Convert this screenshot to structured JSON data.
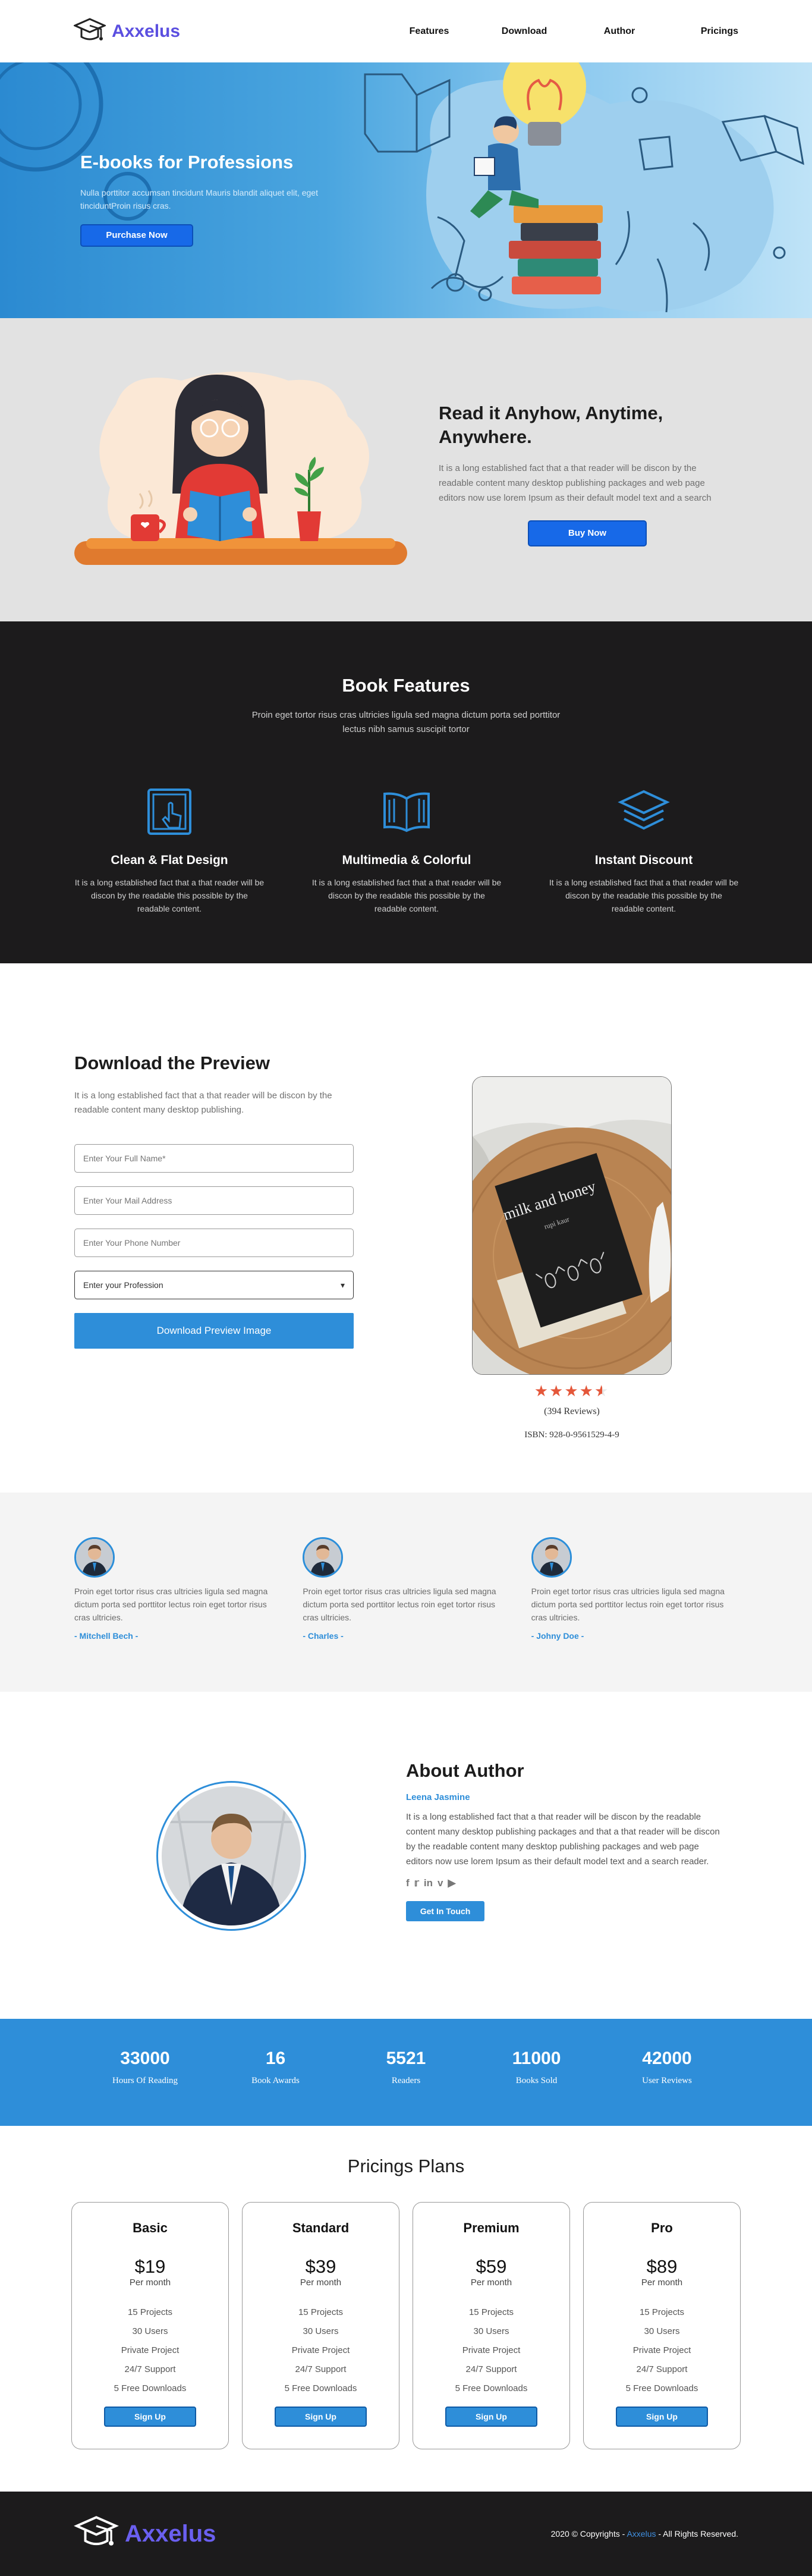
{
  "nav": {
    "brand": "Axxelus",
    "items": [
      "Features",
      "Download",
      "Author",
      "Pricings"
    ]
  },
  "hero": {
    "title": "E-books for Professions",
    "text": "Nulla porttitor accumsan tincidunt Mauris blandit aliquet elit, eget tinciduntProin risus cras.",
    "button": "Purchase Now"
  },
  "read": {
    "title": "Read it Anyhow, Anytime, Anywhere.",
    "text": "It is a long established fact that a that reader will be discon by the readable content many desktop publishing packages and web page editors now use lorem Ipsum as their default model text and a search",
    "button": "Buy Now"
  },
  "features": {
    "title": "Book Features",
    "subtitle": "Proin eget tortor risus cras ultricies ligula sed magna dictum porta sed porttitor lectus nibh samus suscipit tortor",
    "items": [
      {
        "icon": "tap-screen-icon",
        "title": "Clean & Flat Design",
        "text": "It is a long established fact that a that reader will be discon by the readable this possible by the readable content."
      },
      {
        "icon": "open-book-icon",
        "title": "Multimedia & Colorful",
        "text": "It is a long established fact that a that reader will be discon by the readable this possible by the readable content."
      },
      {
        "icon": "layers-icon",
        "title": "Instant Discount",
        "text": "It is a long established fact that a that reader will be discon by the readable this possible by the readable content."
      }
    ]
  },
  "preview": {
    "title": "Download the Preview",
    "text": "It is a long established fact that a that reader will be discon by the readable content many desktop publishing.",
    "name_placeholder": "Enter Your Full Name*",
    "mail_placeholder": "Enter Your Mail Address",
    "phone_placeholder": "Enter Your Phone Number",
    "profession_selected": "Enter your Profession",
    "button": "Download Preview Image",
    "book_title": "milk and honey",
    "book_author": "rupi kaur",
    "rating": 4.5,
    "reviews": "(394 Reviews)",
    "isbn": "ISBN: 928-0-9561529-4-9"
  },
  "testimonials": [
    {
      "text": "Proin eget tortor risus cras ultricies ligula sed magna dictum porta sed porttitor lectus roin eget tortor risus cras ultricies.",
      "name": "- Mitchell Bech -"
    },
    {
      "text": "Proin eget tortor risus cras ultricies ligula sed magna dictum porta sed porttitor lectus roin eget tortor risus cras ultricies.",
      "name": "- Charles -"
    },
    {
      "text": "Proin eget tortor risus cras ultricies ligula sed magna dictum porta sed porttitor lectus roin eget tortor risus cras ultricies.",
      "name": "- Johny Doe -"
    }
  ],
  "about": {
    "title": "About Author",
    "name": "Leena Jasmine",
    "text": "It is a long established fact that a that reader will be discon by the readable content many desktop publishing packages and that a that reader will be discon by the readable content many desktop publishing packages and web page editors now use lorem Ipsum as their default model text and a search reader.",
    "socials": [
      "facebook-icon",
      "twitter-icon",
      "linkedin-icon",
      "vimeo-icon",
      "youtube-icon"
    ],
    "button": "Get In Touch"
  },
  "stats": [
    {
      "num": "33000",
      "label": "Hours Of Reading"
    },
    {
      "num": "16",
      "label": "Book Awards"
    },
    {
      "num": "5521",
      "label": "Readers"
    },
    {
      "num": "11000",
      "label": "Books Sold"
    },
    {
      "num": "42000",
      "label": "User Reviews"
    }
  ],
  "pricing": {
    "title": "Pricings Plans",
    "plans": [
      {
        "name": "Basic",
        "price": "$19",
        "per": "Per month",
        "features": [
          "15 Projects",
          "30 Users",
          "Private Project",
          "24/7 Support",
          "5 Free Downloads"
        ],
        "button": "Sign Up"
      },
      {
        "name": "Standard",
        "price": "$39",
        "per": "Per month",
        "features": [
          "15 Projects",
          "30 Users",
          "Private Project",
          "24/7 Support",
          "5 Free Downloads"
        ],
        "button": "Sign Up"
      },
      {
        "name": "Premium",
        "price": "$59",
        "per": "Per month",
        "features": [
          "15 Projects",
          "30 Users",
          "Private Project",
          "24/7 Support",
          "5 Free Downloads"
        ],
        "button": "Sign Up"
      },
      {
        "name": "Pro",
        "price": "$89",
        "per": "Per month",
        "features": [
          "15 Projects",
          "30 Users",
          "Private Project",
          "24/7 Support",
          "5 Free Downloads"
        ],
        "button": "Sign Up"
      }
    ]
  },
  "footer": {
    "brand": "Axxelus",
    "copy_pre": "2020 © Copyrights - ",
    "copy_brand": "Axxelus",
    "copy_post": " - All Rights Reserved."
  },
  "colors": {
    "accent": "#2e8ed9",
    "brand": "#5b4fe0",
    "dark": "#1c1b1c",
    "button": "#1769e8"
  }
}
